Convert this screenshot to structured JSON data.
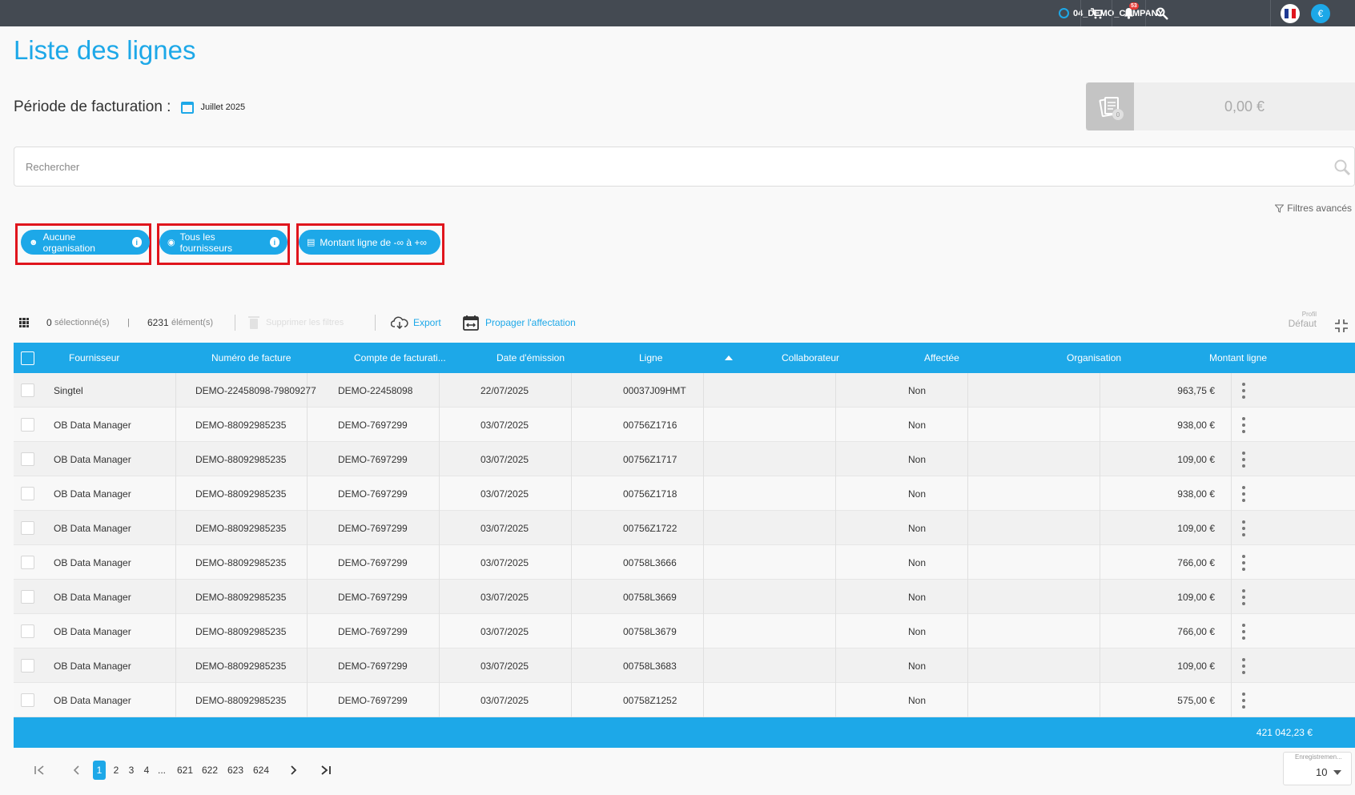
{
  "topbar": {
    "company": "04_DEMO_COMPANY",
    "notification_count": "53",
    "currency_symbol": "€",
    "icons": [
      "globe-icon",
      "cart-icon",
      "bell-icon",
      "search-icon",
      "flag-fr-icon",
      "euro-icon"
    ]
  },
  "page": {
    "title": "Liste des lignes",
    "period_label": "Période de facturation :",
    "period_value": "Juillet 2025",
    "summary_badge": "0",
    "summary_amount": "0,00 €"
  },
  "search": {
    "placeholder": "Rechercher"
  },
  "advanced_filters_label": "Filtres avancés",
  "filters": [
    {
      "label": "Aucune organisation"
    },
    {
      "label": "Tous les fournisseurs"
    },
    {
      "label": "Montant ligne de -∞ à +∞"
    }
  ],
  "toolbar": {
    "selected_count": "0",
    "selected_label": "sélectionné(s)",
    "separator": "|",
    "items_count": "6231",
    "items_label": "élément(s)",
    "clear_filters_label": "Supprimer les filtres",
    "export_label": "Export",
    "propagate_label": "Propager l'affectation",
    "profile_label": "Profil",
    "profile_value": "Défaut"
  },
  "table": {
    "columns": [
      "Fournisseur",
      "Numéro de facture",
      "Compte de facturati...",
      "Date d'émission",
      "Ligne",
      "Collaborateur",
      "Affectée",
      "Organisation",
      "Montant ligne"
    ],
    "sorted_column": "Ligne",
    "sort_direction": "asc",
    "rows": [
      [
        "Singtel",
        "DEMO-22458098-79809277",
        "DEMO-22458098",
        "22/07/2025",
        "00037J09HMT",
        "",
        "Non",
        "",
        "963,75 €"
      ],
      [
        "OB Data Manager",
        "DEMO-88092985235",
        "DEMO-7697299",
        "03/07/2025",
        "00756Z1716",
        "",
        "Non",
        "",
        "938,00 €"
      ],
      [
        "OB Data Manager",
        "DEMO-88092985235",
        "DEMO-7697299",
        "03/07/2025",
        "00756Z1717",
        "",
        "Non",
        "",
        "109,00 €"
      ],
      [
        "OB Data Manager",
        "DEMO-88092985235",
        "DEMO-7697299",
        "03/07/2025",
        "00756Z1718",
        "",
        "Non",
        "",
        "938,00 €"
      ],
      [
        "OB Data Manager",
        "DEMO-88092985235",
        "DEMO-7697299",
        "03/07/2025",
        "00756Z1722",
        "",
        "Non",
        "",
        "109,00 €"
      ],
      [
        "OB Data Manager",
        "DEMO-88092985235",
        "DEMO-7697299",
        "03/07/2025",
        "00758L3666",
        "",
        "Non",
        "",
        "766,00 €"
      ],
      [
        "OB Data Manager",
        "DEMO-88092985235",
        "DEMO-7697299",
        "03/07/2025",
        "00758L3669",
        "",
        "Non",
        "",
        "109,00 €"
      ],
      [
        "OB Data Manager",
        "DEMO-88092985235",
        "DEMO-7697299",
        "03/07/2025",
        "00758L3679",
        "",
        "Non",
        "",
        "766,00 €"
      ],
      [
        "OB Data Manager",
        "DEMO-88092985235",
        "DEMO-7697299",
        "03/07/2025",
        "00758L3683",
        "",
        "Non",
        "",
        "109,00 €"
      ],
      [
        "OB Data Manager",
        "DEMO-88092985235",
        "DEMO-7697299",
        "03/07/2025",
        "00758Z1252",
        "",
        "Non",
        "",
        "575,00 €"
      ]
    ],
    "total": "421 042,23 €"
  },
  "pagination": {
    "pages": [
      "1",
      "2",
      "3",
      "4",
      "...",
      "621",
      "622",
      "623",
      "624"
    ],
    "current_page": "1",
    "per_page_label": "Enregistremen...",
    "per_page_value": "10"
  },
  "colors": {
    "accent": "#1da8e8",
    "topbar": "#444a52",
    "highlight": "#e0151d"
  }
}
